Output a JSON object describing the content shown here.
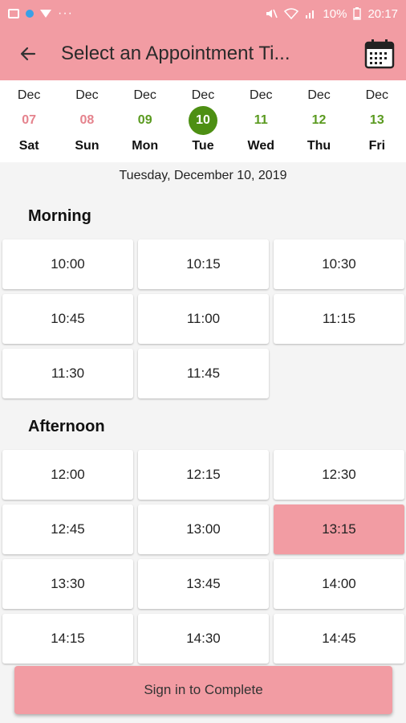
{
  "status_bar": {
    "battery": "10%",
    "time": "20:17",
    "more": "···"
  },
  "app_bar": {
    "title": "Select an Appointment Ti...",
    "back_icon": "arrow-left-icon",
    "calendar_icon": "calendar-icon"
  },
  "week": [
    {
      "month": "Dec",
      "num": "07",
      "name": "Sat",
      "state": "past"
    },
    {
      "month": "Dec",
      "num": "08",
      "name": "Sun",
      "state": "past"
    },
    {
      "month": "Dec",
      "num": "09",
      "name": "Mon",
      "state": "avail"
    },
    {
      "month": "Dec",
      "num": "10",
      "name": "Tue",
      "state": "selected"
    },
    {
      "month": "Dec",
      "num": "11",
      "name": "Wed",
      "state": "avail"
    },
    {
      "month": "Dec",
      "num": "12",
      "name": "Thu",
      "state": "avail"
    },
    {
      "month": "Dec",
      "num": "13",
      "name": "Fri",
      "state": "avail"
    }
  ],
  "selected_date": "Tuesday, December 10, 2019",
  "morning": {
    "title": "Morning",
    "slots": [
      "10:00",
      "10:15",
      "10:30",
      "10:45",
      "11:00",
      "11:15",
      "11:30",
      "11:45"
    ]
  },
  "afternoon": {
    "title": "Afternoon",
    "slots": [
      "12:00",
      "12:15",
      "12:30",
      "12:45",
      "13:00",
      "13:15",
      "13:30",
      "13:45",
      "14:00",
      "14:15",
      "14:30",
      "14:45"
    ],
    "selected": "13:15"
  },
  "cta_label": "Sign in to Complete",
  "colors": {
    "accent": "#f29ca3",
    "green": "#4d8f13",
    "past": "#e5838d"
  }
}
